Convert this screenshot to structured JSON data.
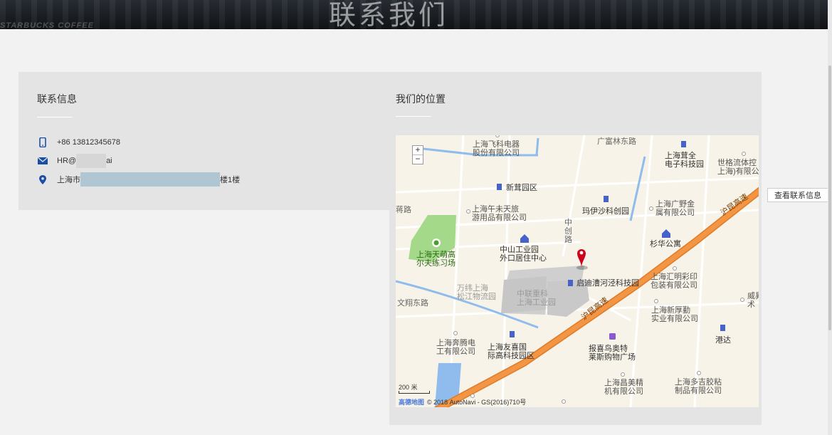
{
  "banner": {
    "title": "联系我们",
    "shop_text": "STARBUCKS COFFEE"
  },
  "contact": {
    "heading": "联系信息",
    "phone": "+86 13812345678",
    "email_prefix": "HR@",
    "email_suffix": "ai",
    "address_prefix": "上海市",
    "address_suffix": "楼1楼"
  },
  "location": {
    "heading": "我们的位置"
  },
  "map": {
    "zoom_in": "+",
    "zoom_out": "−",
    "scale": "200 米",
    "attribution_logo": "高德地图",
    "attribution": "© 2018 AutoNavi - GS(2016)710号",
    "labels": {
      "feike": "上海飞科电器\n股份有限公司",
      "guangfu": "广富林东路",
      "ruiquan": "上海茸全\n电子科技园",
      "shige": "世格流体控\n上海)有限公",
      "xinfei": "新茸园区",
      "wuwei": "上海午未天旅\n游用品有限公司",
      "huhang_road": "蒋路",
      "zhongchuang": "中\n创\n路",
      "mayisha": "玛伊沙科创园",
      "guangye": "上海广野金\n属有限公司",
      "huhang": "沪昆高速",
      "tianmeng": "上海天萌高\n尔夫练习场",
      "zhongshan": "中山工业园\n外口居住中心",
      "shanhua": "杉华公寓",
      "wantong": "万纬上海\n松江物流园",
      "zhonglian": "中联重科\n上海工业园",
      "qidi": "启迪漕河泾科技园",
      "huiming": "上海汇明彩印\n包装有限公司",
      "weixiang": "文翔东路",
      "huhang2": "沪昆高速",
      "xinhoumian": "上海新厚勤\n实业有限公司",
      "weisheng": "威昇\n术",
      "benteng": "上海奔腾电\n工有限公司",
      "youxi": "上海友喜国\n际高科技园区",
      "baoxi": "报喜鸟奥特\n莱斯购物广场",
      "gangda": "港达",
      "changmei": "上海昌美精\n机有限公司",
      "duoji": "上海多吉胶粘\n制品有限公司"
    }
  },
  "button": {
    "view_contact": "查看联系信息"
  },
  "colors": {
    "highway": "#f29544",
    "water": "#8fbcec",
    "park": "#a5d98a",
    "marker": "#d0021b"
  }
}
